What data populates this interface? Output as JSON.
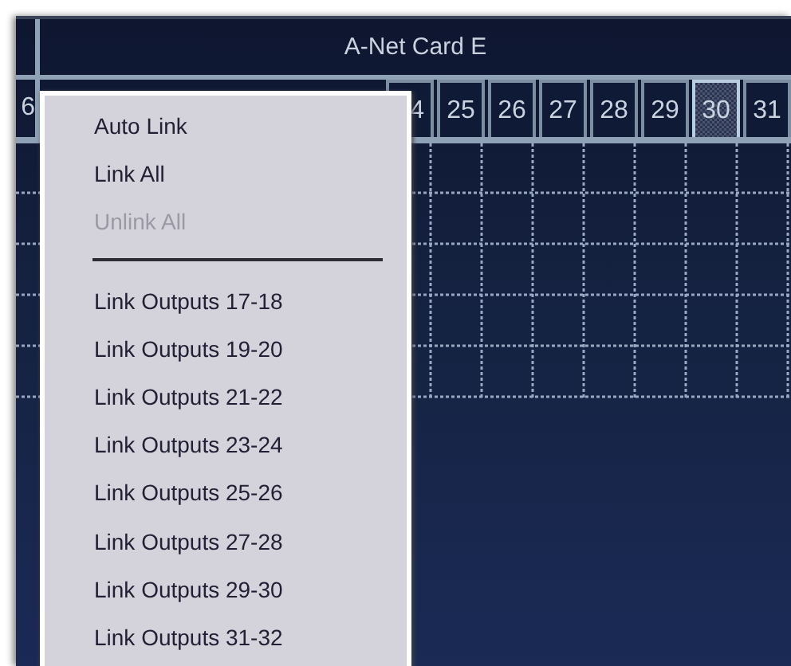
{
  "panel": {
    "title": "A-Net Card E",
    "channels": [
      {
        "label": "6",
        "selected": false
      },
      {
        "label": "4",
        "selected": false
      },
      {
        "label": "25",
        "selected": false
      },
      {
        "label": "26",
        "selected": false
      },
      {
        "label": "27",
        "selected": false
      },
      {
        "label": "28",
        "selected": false
      },
      {
        "label": "29",
        "selected": false
      },
      {
        "label": "30",
        "selected": true
      },
      {
        "label": "31",
        "selected": false
      }
    ]
  },
  "context_menu": {
    "items": [
      {
        "kind": "item",
        "label": "Auto Link",
        "disabled": false
      },
      {
        "kind": "item",
        "label": "Link All",
        "disabled": false
      },
      {
        "kind": "item",
        "label": "Unlink All",
        "disabled": true
      },
      {
        "kind": "separator"
      },
      {
        "kind": "item",
        "label": "Link Outputs 17-18",
        "disabled": false
      },
      {
        "kind": "item",
        "label": "Link Outputs 19-20",
        "disabled": false
      },
      {
        "kind": "item",
        "label": "Link Outputs 21-22",
        "disabled": false
      },
      {
        "kind": "item",
        "label": "Link Outputs 23-24",
        "disabled": false
      },
      {
        "kind": "item",
        "label": "Link Outputs 25-26",
        "disabled": false
      },
      {
        "kind": "item",
        "label": "Link Outputs 27-28",
        "disabled": false
      },
      {
        "kind": "item",
        "label": "Link Outputs 29-30",
        "disabled": false
      },
      {
        "kind": "item",
        "label": "Link Outputs 31-32",
        "disabled": false
      }
    ]
  }
}
